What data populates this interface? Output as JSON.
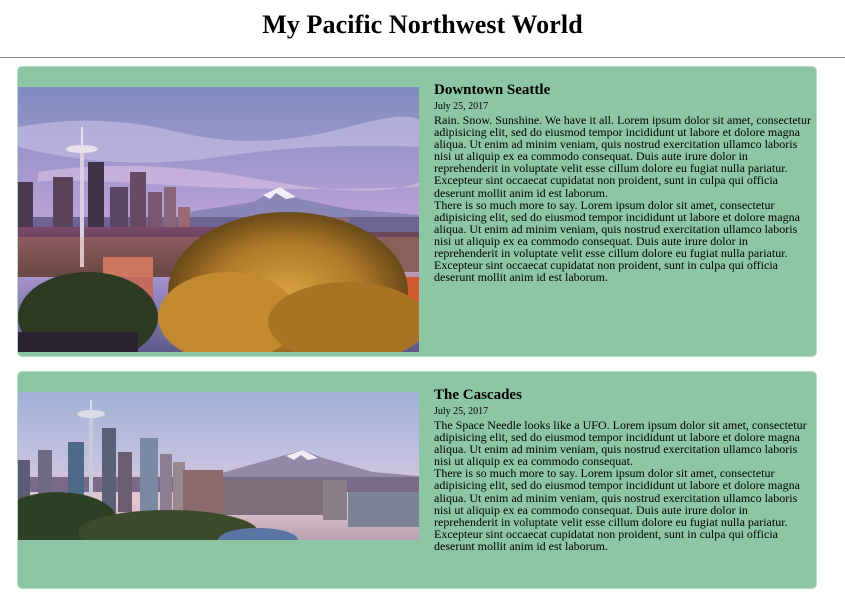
{
  "page": {
    "title": "My Pacific Northwest World"
  },
  "posts": [
    {
      "title": "Downtown Seattle",
      "date": "July 25, 2017",
      "paragraphs": [
        "Rain. Snow. Sunshine. We have it all. Lorem ipsum dolor sit amet, consectetur adipisicing elit, sed do eiusmod tempor incididunt ut labore et dolore magna aliqua. Ut enim ad minim veniam, quis nostrud exercitation ullamco laboris nisi ut aliquip ex ea commodo consequat. Duis aute irure dolor in reprehenderit in voluptate velit esse cillum dolore eu fugiat nulla pariatur. Excepteur sint occaecat cupidatat non proident, sunt in culpa qui officia deserunt mollit anim id est laborum.",
        "There is so much more to say. Lorem ipsum dolor sit amet, consectetur adipisicing elit, sed do eiusmod tempor incididunt ut labore et dolore magna aliqua. Ut enim ad minim veniam, quis nostrud exercitation ullamco laboris nisi ut aliquip ex ea commodo consequat. Duis aute irure dolor in reprehenderit in voluptate velit esse cillum dolore eu fugiat nulla pariatur. Excepteur sint occaecat cupidatat non proident, sunt in culpa qui officia deserunt mollit anim id est laborum."
      ]
    },
    {
      "title": "The Cascades",
      "date": "July 25, 2017",
      "paragraphs": [
        "The Space Needle looks like a UFO. Lorem ipsum dolor sit amet, consectetur adipisicing elit, sed do eiusmod tempor incididunt ut labore et dolore magna aliqua. Ut enim ad minim veniam, quis nostrud exercitation ullamco laboris nisi ut aliquip ex ea commodo consequat.",
        "There is so much more to say. Lorem ipsum dolor sit amet, consectetur adipisicing elit, sed do eiusmod tempor incididunt ut labore et dolore magna aliqua. Ut enim ad minim veniam, quis nostrud exercitation ullamco laboris nisi ut aliquip ex ea commodo consequat. Duis aute irure dolor in reprehenderit in voluptate velit esse cillum dolore eu fugiat nulla pariatur. Excepteur sint occaecat cupidatat non proident, sunt in culpa qui officia deserunt mollit anim id est laborum."
      ]
    }
  ],
  "colors": {
    "card_background": "#8dc6a4",
    "card_border": "#bcd8c6",
    "header_rule": "#8a8a8a"
  }
}
